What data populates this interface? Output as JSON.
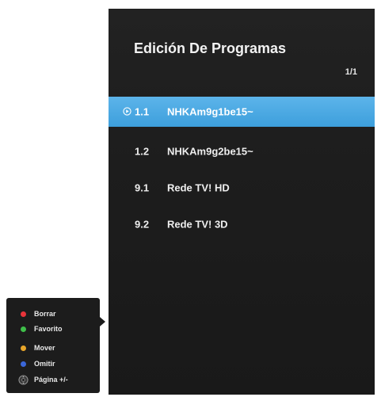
{
  "screen": {
    "title": "Edición De Programas",
    "page_counter": "1/1"
  },
  "channels": [
    {
      "number": "1.1",
      "name": "NHKAm9g1be15~",
      "selected": true
    },
    {
      "number": "1.2",
      "name": "NHKAm9g2be15~",
      "selected": false
    },
    {
      "number": "9.1",
      "name": "Rede TV! HD",
      "selected": false
    },
    {
      "number": "9.2",
      "name": "Rede TV! 3D",
      "selected": false
    }
  ],
  "legend": {
    "delete_label": "Borrar",
    "favorite_label": "Favorito",
    "move_label": "Mover",
    "skip_label": "Omitir",
    "page_label": "Página +/-",
    "colors": {
      "red": "#e8343a",
      "green": "#3fbf4a",
      "yellow": "#e8a62a",
      "blue": "#3a66d8"
    }
  },
  "colors": {
    "panel_bg": "#1e1e1e",
    "selection": "#4aa8e2"
  }
}
